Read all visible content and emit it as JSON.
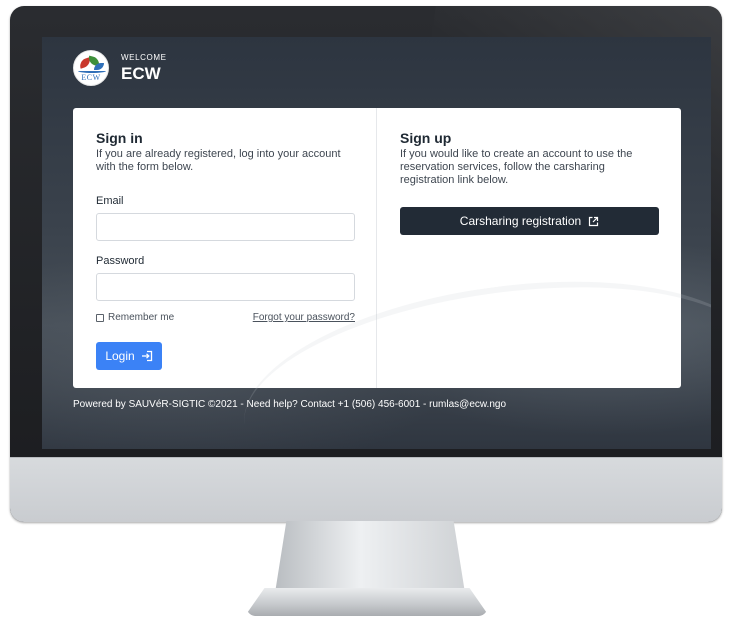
{
  "header": {
    "welcome": "WELCOME",
    "brand": "ECW",
    "logo_text": "ECW"
  },
  "signin": {
    "title": "Sign in",
    "description": "If you are already registered, log into your account with the form below.",
    "email_label": "Email",
    "email_value": "",
    "password_label": "Password",
    "password_value": "",
    "remember_label": "Remember me",
    "remember_checked": false,
    "forgot_label": "Forgot your password?",
    "login_label": "Login",
    "login_icon": "login-arrow-icon"
  },
  "signup": {
    "title": "Sign up",
    "description": "If you would like to create an account to use the reservation services, follow the carsharing registration link below.",
    "register_label": "Carsharing registration",
    "register_icon": "external-link-icon"
  },
  "footer": {
    "text": "Powered by SAUVéR-SIGTIC ©2021 - Need help? Contact +1 (506) 456-6001 - rumlas@ecw.ngo"
  },
  "colors": {
    "primary": "#3b82f6",
    "dark_button": "#222b36",
    "card": "#ffffff"
  }
}
